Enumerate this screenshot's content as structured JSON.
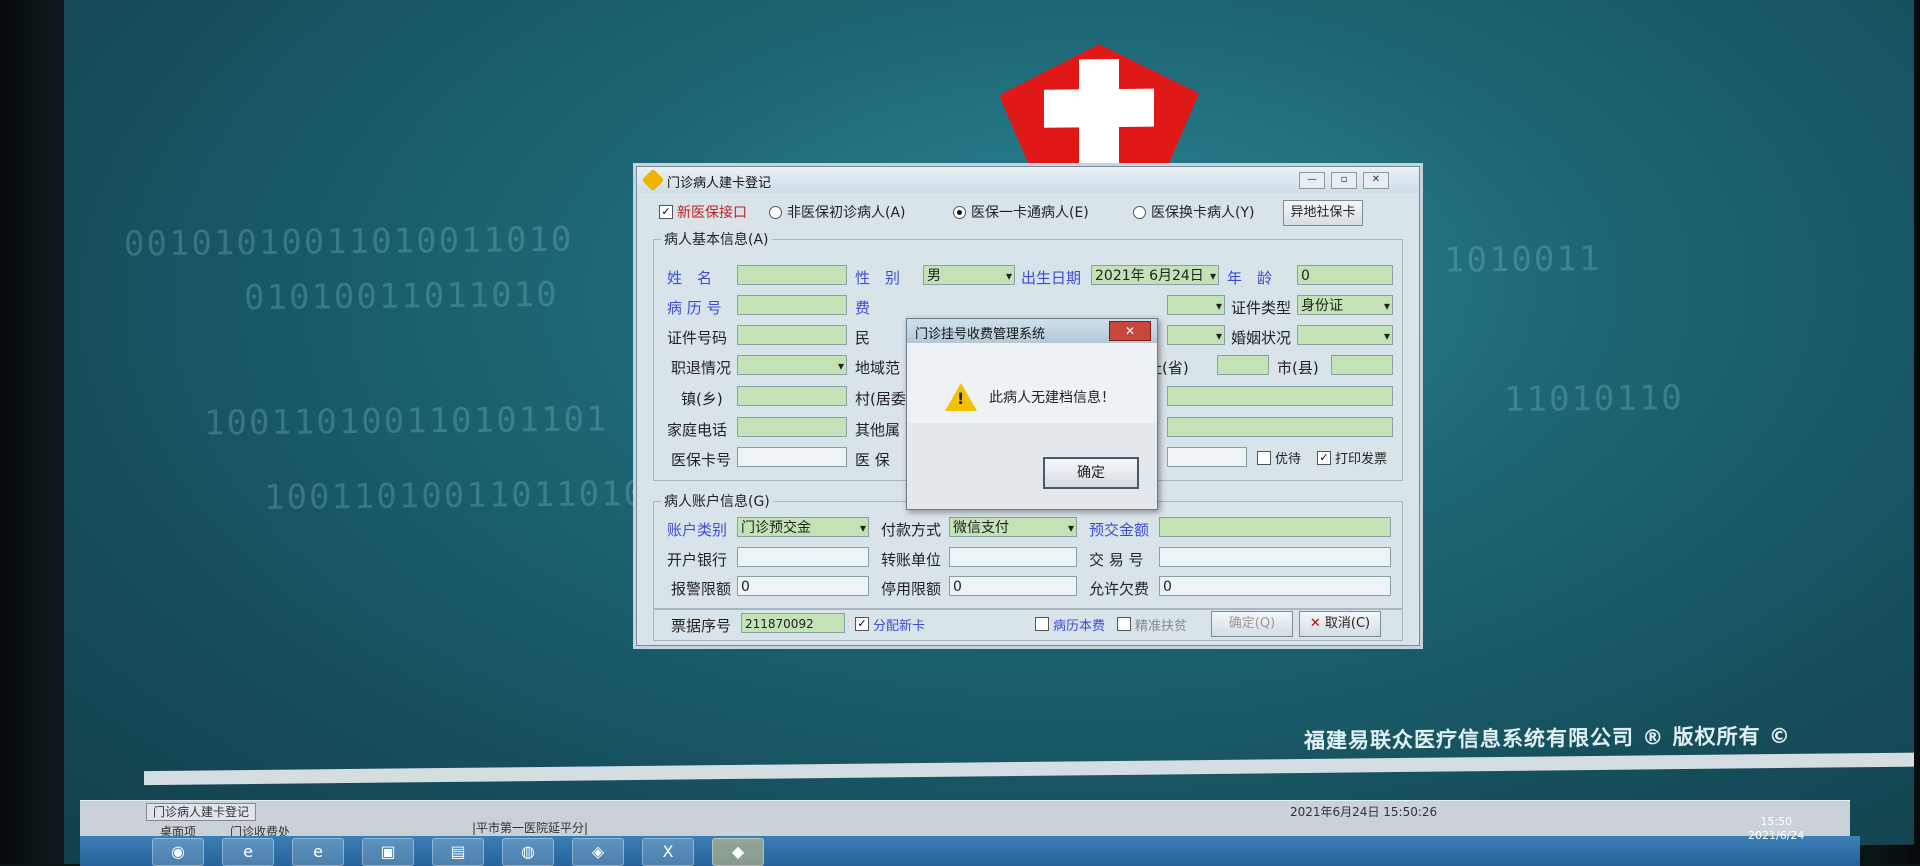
{
  "desktop": {
    "slogan": "福建易联众医疗信息系统有限公司 ® 版权所有 ©",
    "status_tab": "门诊病人建卡登记",
    "status_bottom_left": "桌面项",
    "status_bottom_mid": "门诊收费处",
    "status_bottom_hospital": "|平市第一医院延平分|",
    "status_datetime": "2021年6月24日 15:50:26",
    "clock_time": "15:50",
    "clock_date": "2021/6/24"
  },
  "window": {
    "title": "门诊病人建卡登记",
    "new_insurance_label": "新医保接口",
    "radio_non_insured": "非医保初诊病人(A)",
    "radio_one_card": "医保一卡通病人(E)",
    "radio_swap_card": "医保换卡病人(Y)",
    "offsite_card_button": "异地社保卡",
    "basic_group_label": "病人基本信息(A)",
    "name_label": "姓　名",
    "gender_label": "性　别",
    "gender_value": "男",
    "birthdate_label": "出生日期",
    "birthdate_value": "2021年 6月24日",
    "age_label": "年　龄",
    "age_value": "0",
    "record_no_label": "病 历 号",
    "fee_label": "费",
    "id_type_label": "证件类型",
    "id_type_value": "身份证",
    "id_no_label": "证件号码",
    "ethnic_label": "民",
    "marital_label": "婚姻状况",
    "retire_label": "职退情况",
    "region_label": "地域范",
    "address_province_label": "址(省)",
    "city_label": "市(县)",
    "town_label": "镇(乡)",
    "village_label": "村(居委",
    "home_phone_label": "家庭电话",
    "other_label": "其他属",
    "insurance_card_label": "医保卡号",
    "medical_label": "医 保",
    "priority_label": "优待",
    "print_invoice_label": "打印发票",
    "account_group_label": "病人账户信息(G)",
    "account_type_label": "账户类别",
    "account_type_value": "门诊预交金",
    "pay_method_label": "付款方式",
    "pay_method_value": "微信支付",
    "prepay_label": "预交金额",
    "bank_label": "开户银行",
    "transfer_label": "转账单位",
    "trade_no_label": "交 易 号",
    "alarm_limit_label": "报警限额",
    "alarm_limit_value": "0",
    "stop_limit_label": "停用限额",
    "stop_limit_value": "0",
    "allow_debt_label": "允许欠费",
    "allow_debt_value": "0",
    "receipt_no_label": "票据序号",
    "receipt_no_value": "211870092",
    "assign_card_label": "分配新卡",
    "record_book_label": "病历本费",
    "precise_label": "精准扶贫",
    "confirm_button": "确定(Q)",
    "cancel_button": "取消(C)"
  },
  "dialog": {
    "title": "门诊挂号收费管理系统",
    "message": "此病人无建档信息！",
    "ok_button": "确定"
  }
}
